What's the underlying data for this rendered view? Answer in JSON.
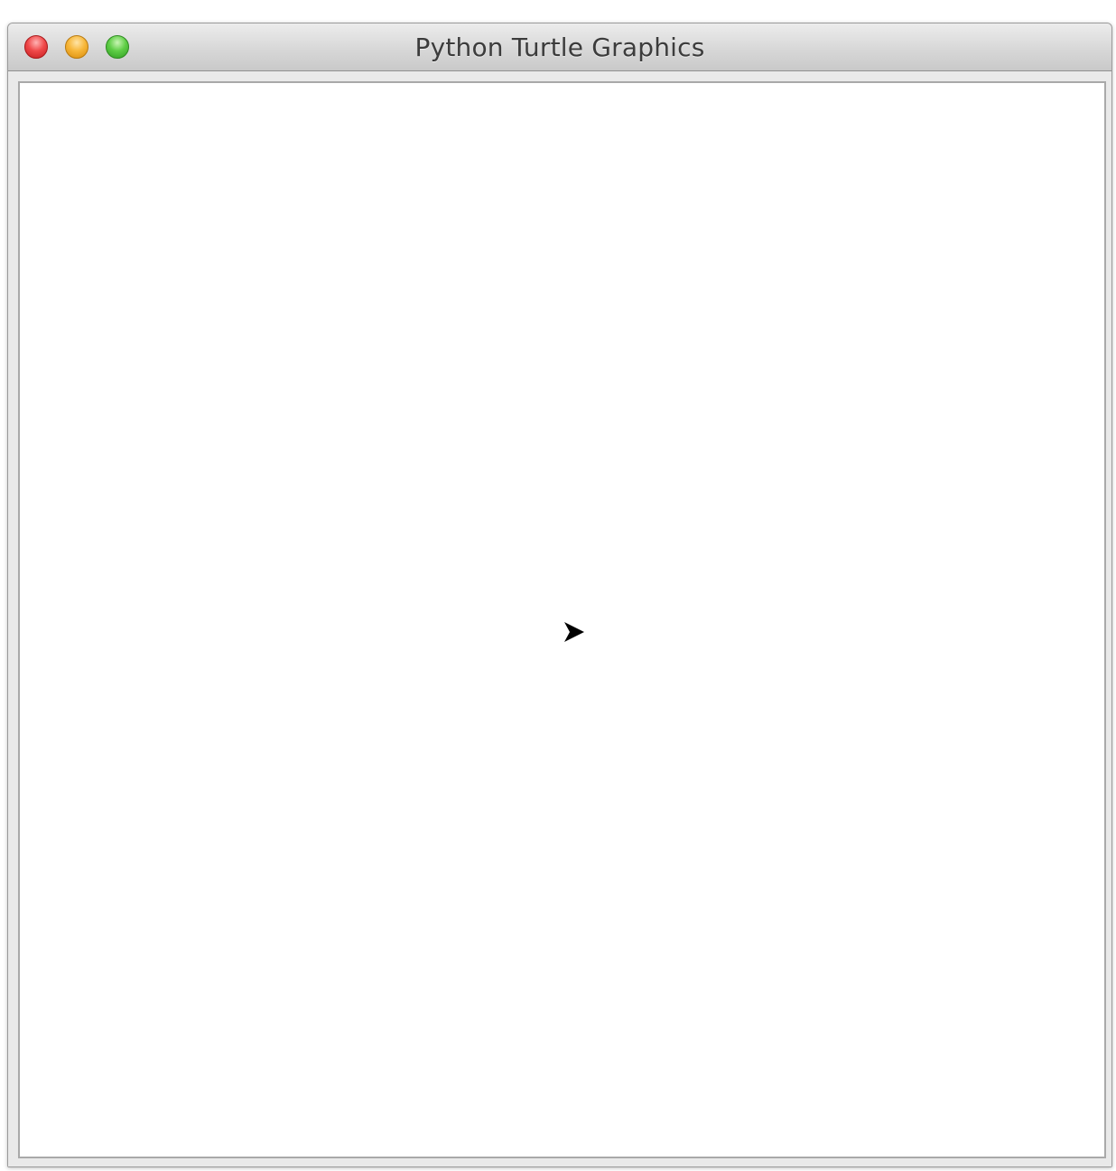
{
  "window": {
    "title": "Python Turtle Graphics",
    "controls": {
      "close": "close-icon",
      "minimize": "minimize-icon",
      "zoom": "zoom-icon"
    }
  },
  "canvas": {
    "background": "#ffffff",
    "turtle": {
      "icon": "arrow-turtle-icon",
      "heading": "east",
      "color": "#000000"
    }
  }
}
